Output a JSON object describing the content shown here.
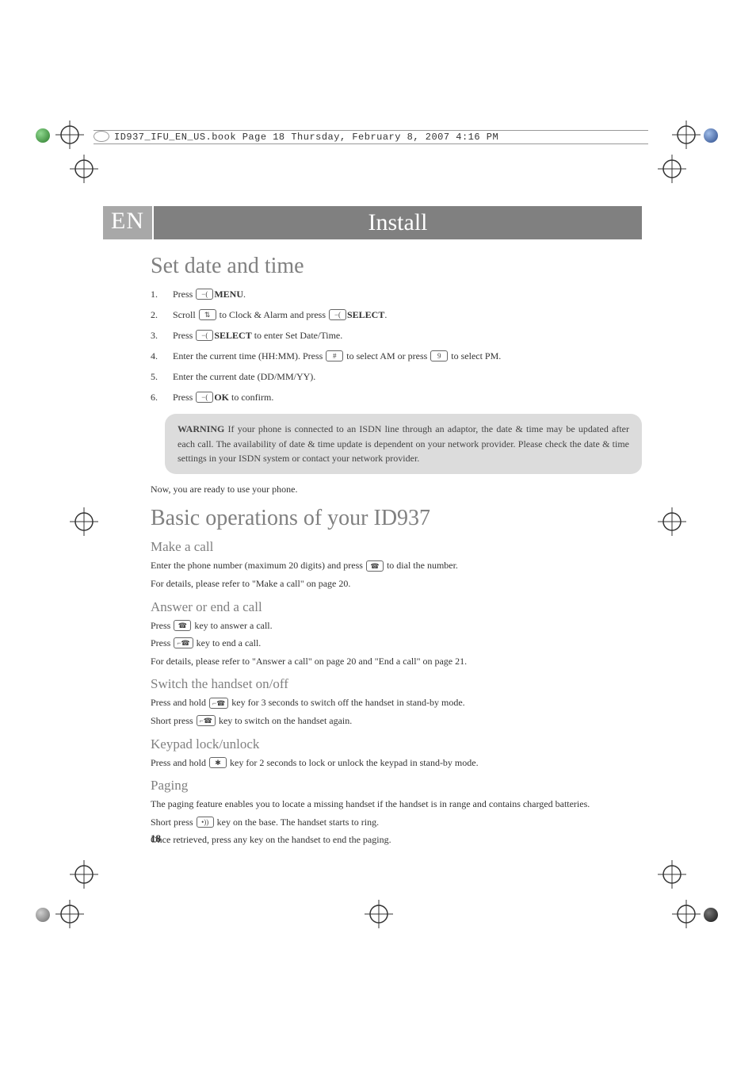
{
  "collation": "ID937_IFU_EN_US.book  Page 18  Thursday, February 8, 2007  4:16 PM",
  "lang": "EN",
  "title": "Install",
  "section1": {
    "heading": "Set date and time",
    "steps": [
      {
        "pre": "Press ",
        "icon": "−(",
        "label": "MENU",
        "post": "."
      },
      {
        "pre": "Scroll ",
        "icon": "⇅",
        "mid": " to Clock & Alarm and press ",
        "icon2": "−(",
        "label": "SELECT",
        "post": "."
      },
      {
        "pre": "Press ",
        "icon": "−(",
        "label": "SELECT",
        "post": " to enter Set Date/Time."
      },
      {
        "pre": "Enter the current time (HH:MM). Press ",
        "icon": "#",
        "mid": " to select AM or press ",
        "icon2": "9",
        "post": " to select PM."
      },
      {
        "pre": "Enter the current date (DD/MM/YY).",
        "icon": "",
        "post": ""
      },
      {
        "pre": "Press ",
        "icon": "−(",
        "label": "OK",
        "post": " to confirm."
      }
    ],
    "warning_label": "WARNING",
    "warning_text": " If your phone is connected to an ISDN line through an adaptor, the date & time may be updated after each call. The availability of date & time update is dependent on your network provider. Please check the date & time settings in your ISDN system or contact your network provider.",
    "after": "Now, you are ready to use your phone."
  },
  "section2": {
    "heading": "Basic operations of your ID937",
    "make_call": {
      "h": "Make a call",
      "p1a": "Enter the phone number (maximum 20 digits) and press ",
      "p1b": " to dial the number.",
      "p2": "For details, please refer to \"Make a call\" on page 20."
    },
    "answer": {
      "h": "Answer or end a call",
      "p1a": "Press ",
      "p1b": " key to answer a call.",
      "p2a": "Press ",
      "p2b": " key to end a call.",
      "p3": "For details, please refer to \"Answer a call\" on page 20 and \"End a call\" on page 21."
    },
    "switch": {
      "h": "Switch the handset on/off",
      "p1a": "Press and hold ",
      "p1b": " key for 3 seconds to switch off the handset in stand-by mode.",
      "p2a": "Short press ",
      "p2b": " key to switch on the handset again."
    },
    "keypad": {
      "h": "Keypad lock/unlock",
      "p1a": "Press and hold ",
      "p1b": " key for 2 seconds to lock or unlock the keypad in stand-by mode."
    },
    "paging": {
      "h": "Paging",
      "p1": "The paging feature enables you to locate a missing handset if the handset is in range and contains charged batteries.",
      "p2a": "Short press ",
      "p2b": " key on the base. The handset starts to ring.",
      "p3": "Once retrieved, press any key on the handset to end the paging."
    }
  },
  "page_number": "18",
  "icons": {
    "talk": "☎",
    "end": "⌐☎",
    "star": "✱",
    "page": "•))"
  }
}
